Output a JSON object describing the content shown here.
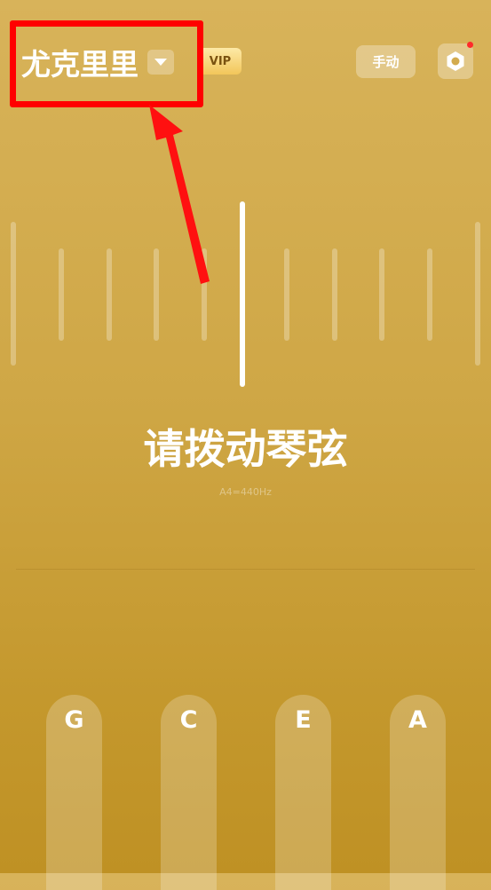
{
  "header": {
    "instrument_name": "尤克里里",
    "vip_label": "VIP",
    "mode_label": "手动"
  },
  "tuner": {
    "prompt": "请拨动琴弦",
    "reference": "A4=440Hz"
  },
  "strings": [
    {
      "label": "G"
    },
    {
      "label": "C"
    },
    {
      "label": "E"
    },
    {
      "label": "A"
    }
  ],
  "icons": {
    "dropdown": "chevron-down-icon",
    "settings": "gear-icon"
  },
  "colors": {
    "highlight": "#ff0000",
    "notification": "#ff2a2a"
  }
}
